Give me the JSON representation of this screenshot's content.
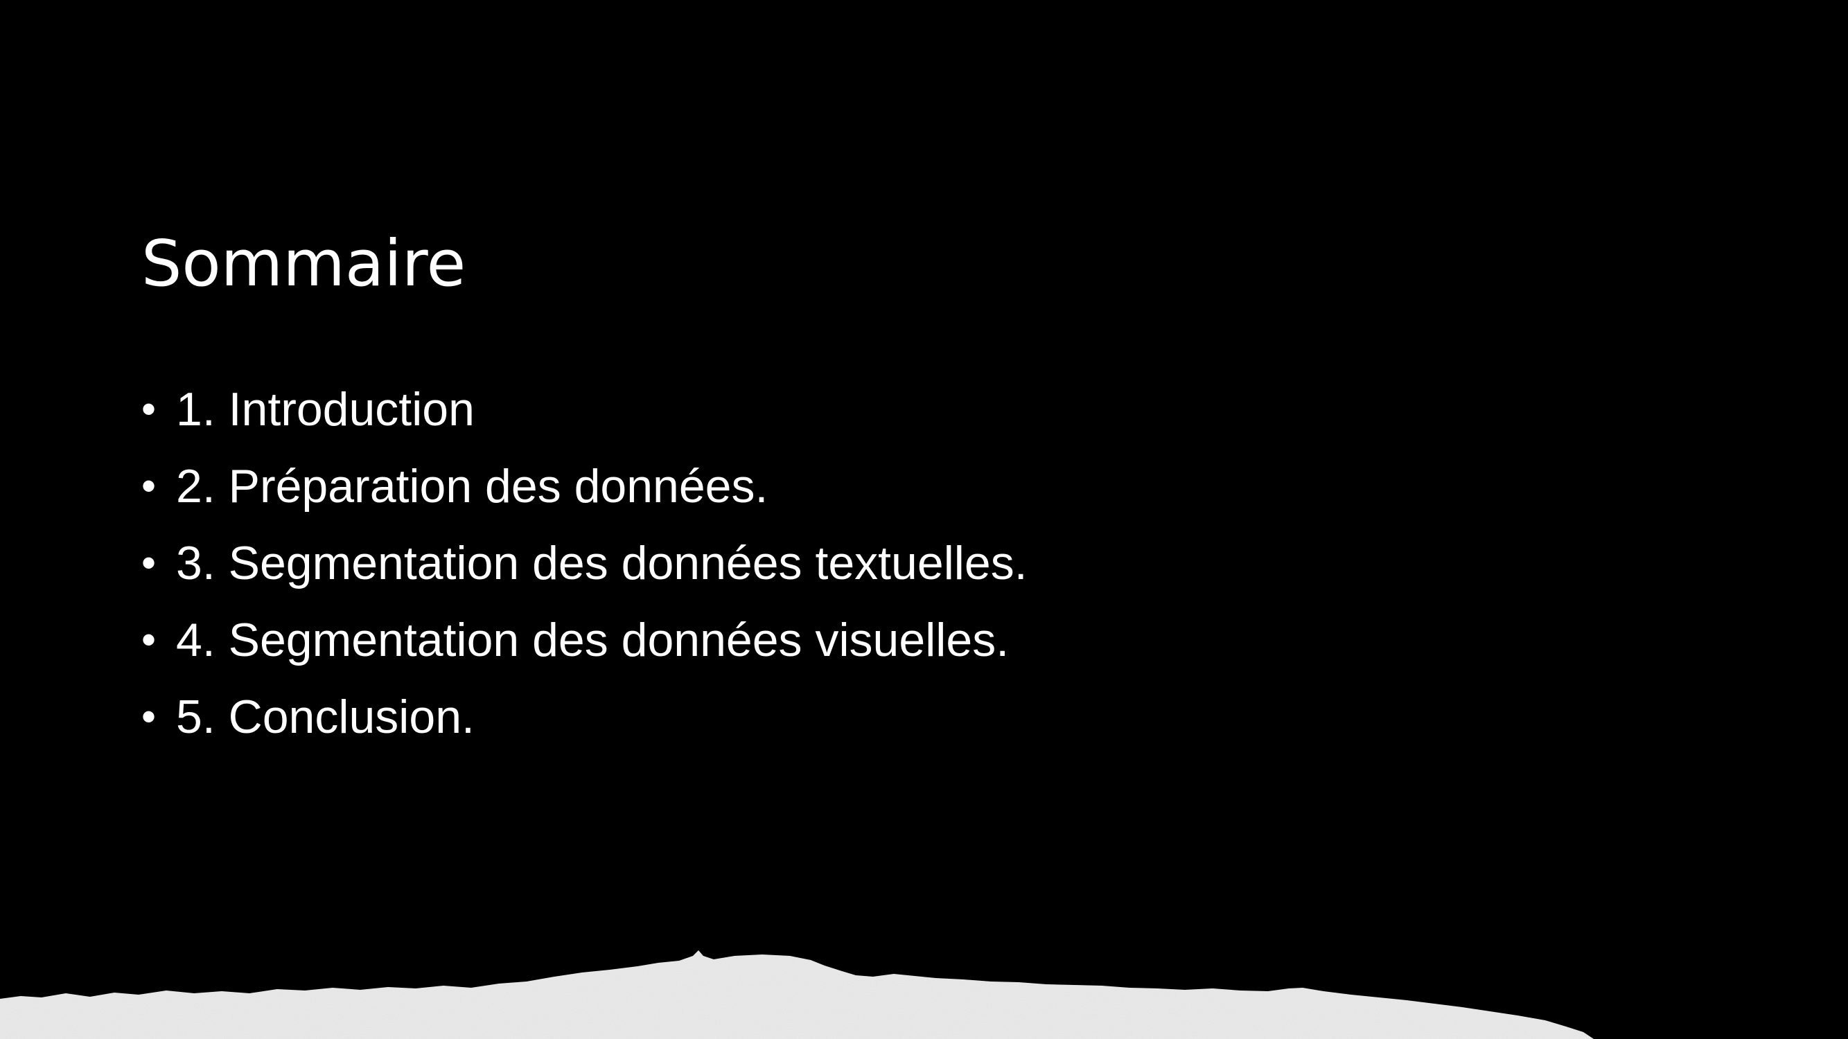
{
  "slide": {
    "title": "Sommaire",
    "bullet_glyph": "•",
    "items": [
      {
        "label": "1. Introduction"
      },
      {
        "label": "2. Préparation des données."
      },
      {
        "label": "3. Segmentation des données textuelles."
      },
      {
        "label": "4. Segmentation des données visuelles."
      },
      {
        "label": "5. Conclusion."
      }
    ]
  },
  "colors": {
    "background": "#000000",
    "text": "#ffffff",
    "paper": "#ededed"
  }
}
